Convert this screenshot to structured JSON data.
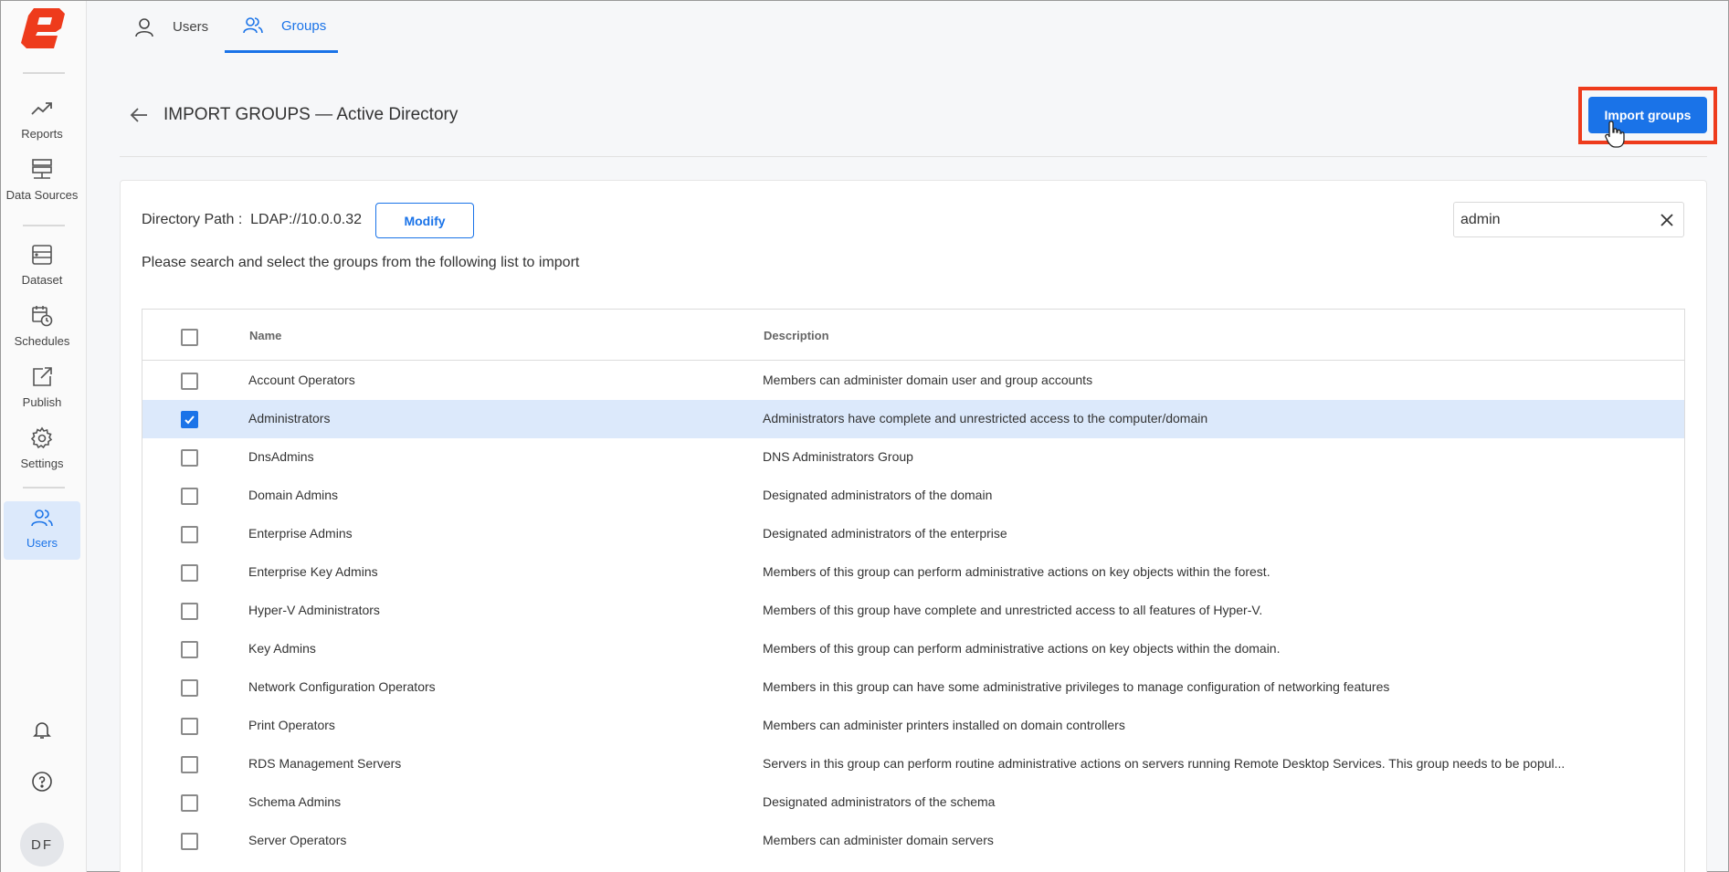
{
  "sidebar": {
    "items": [
      {
        "label": "Reports",
        "icon": "trending-up-icon"
      },
      {
        "label": "Data Sources",
        "icon": "server-icon"
      },
      {
        "label": "Dataset",
        "icon": "dataset-icon"
      },
      {
        "label": "Schedules",
        "icon": "calendar-clock-icon"
      },
      {
        "label": "Publish",
        "icon": "publish-icon"
      },
      {
        "label": "Settings",
        "icon": "gear-icon"
      },
      {
        "label": "Users",
        "icon": "users-icon"
      }
    ],
    "active": "Users",
    "avatar_initials": "DF",
    "brand_color": "#ee3b1c"
  },
  "tabs": [
    {
      "label": "Users",
      "icon": "user-icon",
      "active": false
    },
    {
      "label": "Groups",
      "icon": "group-icon",
      "active": true
    }
  ],
  "header": {
    "title": "IMPORT GROUPS — Active Directory",
    "import_button": "Import groups"
  },
  "directory": {
    "label": "Directory Path :  LDAP://10.0.0.32",
    "modify_button": "Modify"
  },
  "search": {
    "value": "admin",
    "placeholder": ""
  },
  "instruction": "Please search and select the groups from the following list to import",
  "table": {
    "columns": [
      "Name",
      "Description"
    ],
    "rows": [
      {
        "name": "Account Operators",
        "description": "Members can administer domain user and group accounts",
        "checked": false
      },
      {
        "name": "Administrators",
        "description": "Administrators have complete and unrestricted access to the computer/domain",
        "checked": true
      },
      {
        "name": "DnsAdmins",
        "description": "DNS Administrators Group",
        "checked": false
      },
      {
        "name": "Domain Admins",
        "description": "Designated administrators of the domain",
        "checked": false
      },
      {
        "name": "Enterprise Admins",
        "description": "Designated administrators of the enterprise",
        "checked": false
      },
      {
        "name": "Enterprise Key Admins",
        "description": "Members of this group can perform administrative actions on key objects within the forest.",
        "checked": false
      },
      {
        "name": "Hyper-V Administrators",
        "description": "Members of this group have complete and unrestricted access to all features of Hyper-V.",
        "checked": false
      },
      {
        "name": "Key Admins",
        "description": "Members of this group can perform administrative actions on key objects within the domain.",
        "checked": false
      },
      {
        "name": "Network Configuration Operators",
        "description": "Members in this group can have some administrative privileges to manage configuration of networking features",
        "checked": false
      },
      {
        "name": "Print Operators",
        "description": "Members can administer printers installed on domain controllers",
        "checked": false
      },
      {
        "name": "RDS Management Servers",
        "description": "Servers in this group can perform routine administrative actions on servers running Remote Desktop Services. This group needs to be popul...",
        "checked": false
      },
      {
        "name": "Schema Admins",
        "description": "Designated administrators of the schema",
        "checked": false
      },
      {
        "name": "Server Operators",
        "description": "Members can administer domain servers",
        "checked": false
      }
    ]
  },
  "colors": {
    "accent": "#1a73e8",
    "selected_row": "#dce9fb",
    "highlight": "#ee3b1c"
  }
}
